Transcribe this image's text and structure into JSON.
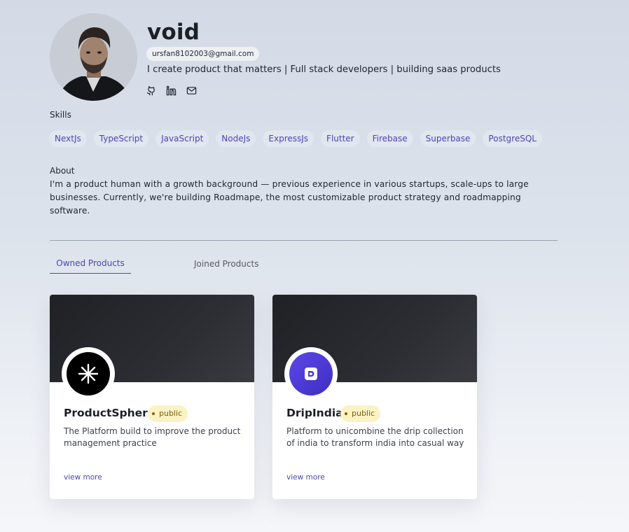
{
  "profile": {
    "name": "void",
    "email": "ursfan8102003@gmail.com",
    "bio": "I create product that matters | Full stack developers | building saas products",
    "socials": [
      {
        "icon": "github-icon"
      },
      {
        "icon": "linkedin-icon"
      },
      {
        "icon": "mail-icon"
      }
    ]
  },
  "skills": {
    "title": "Skills",
    "items": [
      "NextJs",
      "TypeScript",
      "JavaScript",
      "NodeJs",
      "ExpressJs",
      "Flutter",
      "Firebase",
      "Superbase",
      "PostgreSQL"
    ]
  },
  "about": {
    "title": "About",
    "text": "I'm a product human with a growth background — previous experience in various startups, scale-ups to large businesses. Currently, we're building Roadmape, the most customizable product strategy and roadmapping software."
  },
  "tabs": {
    "owned": "Owned Products",
    "joined": "Joined Products"
  },
  "products": [
    {
      "name": "ProductSphere",
      "badge": "public",
      "description": "The Platform build to improve the product management practice",
      "link": "view more",
      "logo_color": "#000000"
    },
    {
      "name": "DripIndia",
      "badge": "public",
      "description": "Platform to unicombine the drip collection of india to transform india into casual way",
      "link": "view more",
      "logo_color": "#4f3bd6"
    }
  ],
  "colors": {
    "accent": "#4a46b5",
    "badge_bg": "#fbf3c4"
  }
}
